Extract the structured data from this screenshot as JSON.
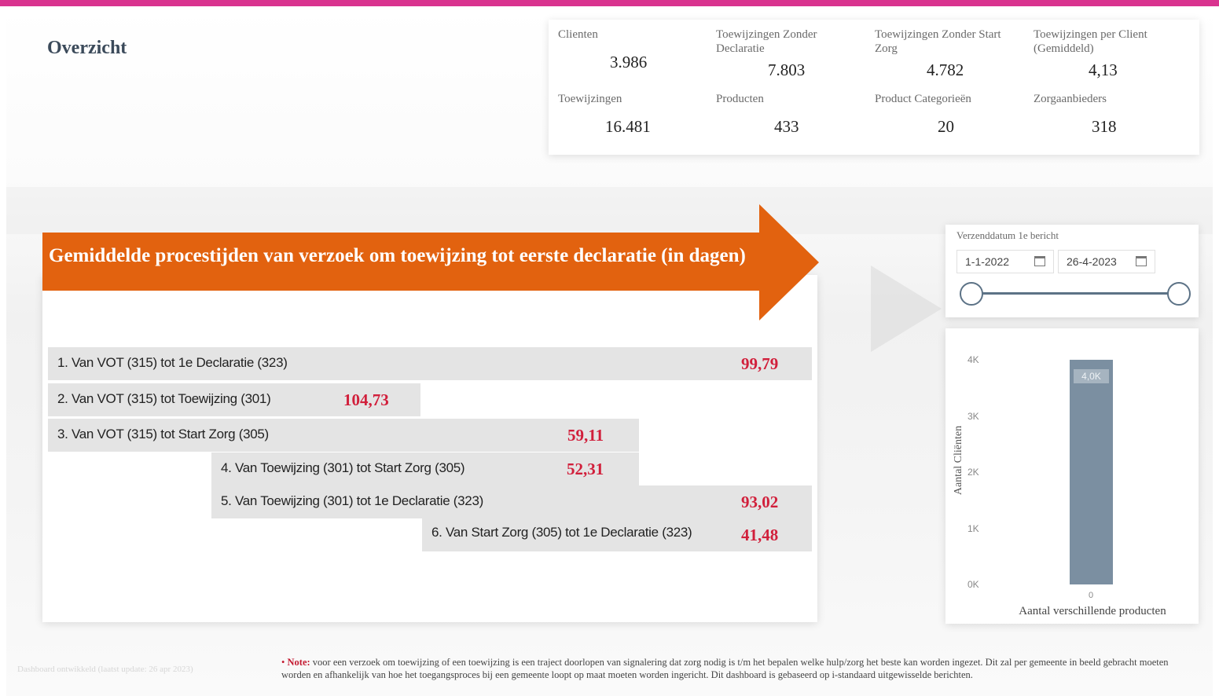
{
  "page": {
    "title": "Overzicht",
    "accent_color": "#d9338f"
  },
  "kpis": [
    {
      "label": "Clienten",
      "value": "3.986"
    },
    {
      "label": "Toewijzingen Zonder Declaratie",
      "value": "7.803"
    },
    {
      "label": "Toewijzingen Zonder Start Zorg",
      "value": "4.782"
    },
    {
      "label": "Toewijzingen per Client (Gemiddeld)",
      "value": "4,13"
    },
    {
      "label": "Toewijzingen",
      "value": "16.481"
    },
    {
      "label": "Producten",
      "value": "433"
    },
    {
      "label": "Product Categorieën",
      "value": "20"
    },
    {
      "label": "Zorgaanbieders",
      "value": "318"
    }
  ],
  "process": {
    "heading": "Gemiddelde procestijden van verzoek om toewijzing tot eerste declaratie (in dagen)",
    "heading_color": "#e2620f",
    "value_color": "#d11f3b",
    "rows": [
      {
        "label": "1. Van VOT (315) tot 1e Declaratie (323)",
        "value": "99,79"
      },
      {
        "label": "2. Van VOT (315) tot Toewijzing (301)",
        "value": "104,73"
      },
      {
        "label": "3. Van VOT (315) tot Start Zorg (305)",
        "value": "59,11"
      },
      {
        "label": "4. Van Toewijzing (301) tot Start Zorg (305)",
        "value": "52,31"
      },
      {
        "label": "5. Van Toewijzing (301) tot 1e Declaratie (323)",
        "value": "93,02"
      },
      {
        "label": "6. Van Start Zorg (305) tot 1e Declaratie (323)",
        "value": "41,48"
      }
    ]
  },
  "date_filter": {
    "label": "Verzenddatum 1e bericht",
    "start": "1-1-2022",
    "end": "26-4-2023",
    "start_icon": "calendar-icon",
    "end_icon": "calendar-icon"
  },
  "chart_data": {
    "type": "bar",
    "categories": [
      "0"
    ],
    "values": [
      4.0
    ],
    "data_labels": [
      "4,0K"
    ],
    "ylabel": "Aantal Cliënten",
    "xlabel": "Aantal verschillende producten",
    "yticks": [
      "0K",
      "1K",
      "2K",
      "3K",
      "4K"
    ],
    "ylim": [
      0,
      4.0
    ],
    "bar_color": "#7b8fa1"
  },
  "footer": {
    "left_text": "Dashboard ontwikkeld (laatst update: 26 apr 2023)",
    "bullet": "•",
    "note_head": "Note:",
    "note_text": " voor een verzoek om toewijzing of een toewijzing is een traject doorlopen van signalering dat zorg nodig is t/m het bepalen welke hulp/zorg het beste kan worden ingezet. Dit zal per gemeente in beeld gebracht moeten worden en afhankelijk van hoe het toegangsproces bij een gemeente loopt op maat moeten worden ingericht. Dit dashboard is gebaseerd op i-standaard uitgewisselde berichten."
  }
}
